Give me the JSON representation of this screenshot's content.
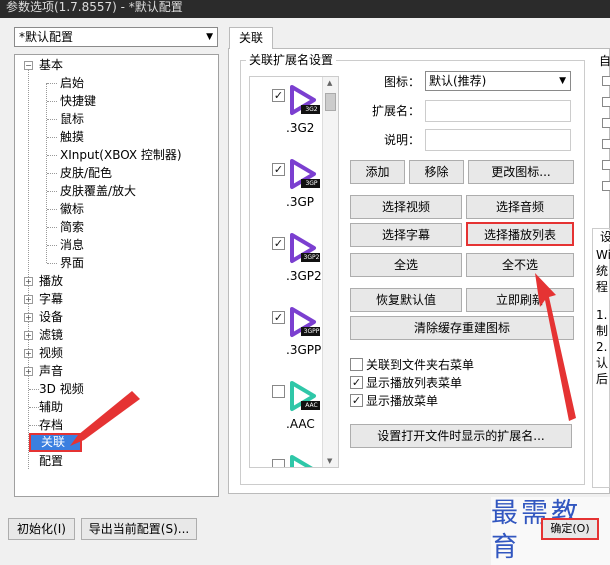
{
  "window": {
    "title": "参数选项(1.7.8557) - *默认配置"
  },
  "preset": {
    "value": "*默认配置"
  },
  "tree": {
    "basic": "基本",
    "basic_children": [
      "启始",
      "快捷键",
      "鼠标",
      "触摸",
      "XInput(XBOX 控制器)",
      "皮肤/配色",
      "皮肤覆盖/放大",
      "徽标",
      "简索",
      "消息",
      "界面"
    ],
    "expanders": [
      "播放",
      "字幕",
      "设备",
      "滤镜",
      "视频",
      "声音"
    ],
    "plain": [
      "3D 视频",
      "辅助",
      "存档"
    ],
    "selected": "关联",
    "last": "配置"
  },
  "tab": {
    "label": "关联"
  },
  "assoc": {
    "group_title": "关联扩展名设置",
    "extensions": [
      {
        "name": ".3G2",
        "badge": "3G2",
        "checked": true,
        "color": "#7b3fd0"
      },
      {
        "name": ".3GP",
        "badge": "3GP",
        "checked": true,
        "color": "#7b3fd0"
      },
      {
        "name": ".3GP2",
        "badge": "3GP2",
        "checked": true,
        "color": "#7b3fd0"
      },
      {
        "name": ".3GPP",
        "badge": "3GPP",
        "checked": true,
        "color": "#7b3fd0"
      },
      {
        "name": ".AAC",
        "badge": "AAC",
        "checked": false,
        "color": "#2fc7a8"
      },
      {
        "name": "",
        "badge": "",
        "checked": false,
        "color": "#2fc7a8"
      }
    ],
    "icon_label": "图标：",
    "icon_value": "默认(推荐)",
    "ext_label": "扩展名：",
    "desc_label": "说明：",
    "buttons": {
      "add": "添加",
      "remove": "移除",
      "change_icon": "更改图标...",
      "select_video": "选择视频",
      "select_audio": "选择音频",
      "select_subtitle": "选择字幕",
      "select_playlist": "选择播放列表",
      "select_all": "全选",
      "select_none": "全不选",
      "restore": "恢复默认值",
      "apply": "立即刷新",
      "clear_cache": "清除缓存重建图标",
      "set_ext": "设置打开文件时显示的扩展名..."
    },
    "checks": [
      {
        "label": "关联到文件夹右菜单",
        "checked": false
      },
      {
        "label": "显示播放列表菜单",
        "checked": true
      },
      {
        "label": "显示播放菜单",
        "checked": true
      }
    ]
  },
  "right": {
    "partial1": "自",
    "partial2": "设",
    "wi": "Wi",
    "tong": "统",
    "cheng": "程",
    "n1": "1.",
    "zhi": "制",
    "n2": "2.",
    "ren": "认",
    "hou": "后"
  },
  "bottom": {
    "init": "初始化(I)",
    "export": "导出当前配置(S)...",
    "ok": "确定(O)"
  },
  "watermark": {
    "text": "最需教育"
  }
}
